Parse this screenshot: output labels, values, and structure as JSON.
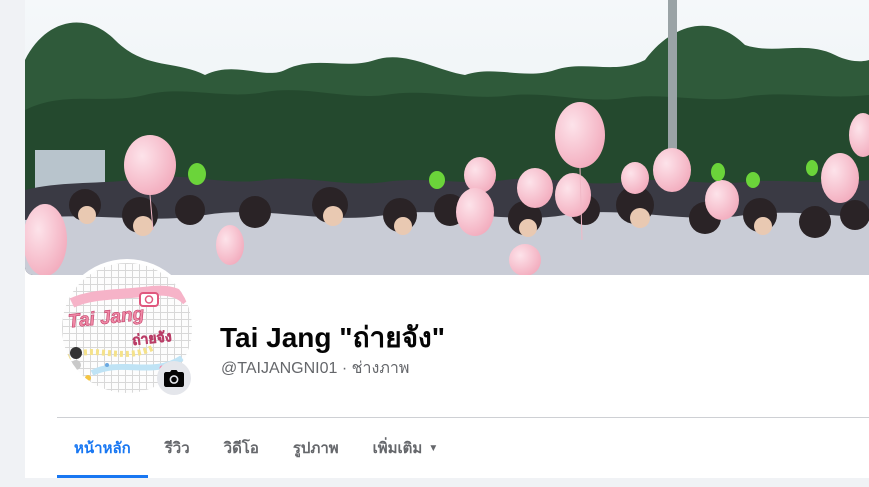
{
  "profile": {
    "name": "Tai Jang \"ถ่ายจัง\"",
    "username": "@TAIJANGNI01",
    "separator": "·",
    "category": "ช่างภาพ",
    "logo_text_1": "Tai Jang",
    "logo_text_2": "ถ่ายจัง"
  },
  "tabs": [
    {
      "label": "หน้าหลัก",
      "active": true
    },
    {
      "label": "รีวิว",
      "active": false
    },
    {
      "label": "วิดีโอ",
      "active": false
    },
    {
      "label": "รูปภาพ",
      "active": false
    },
    {
      "label": "เพิ่มเติม",
      "active": false,
      "dropdown": true
    }
  ],
  "icons": {
    "camera": "camera-icon",
    "dropdown": "caret-down-icon"
  },
  "colors": {
    "accent": "#1877f2",
    "text_primary": "#050505",
    "text_secondary": "#65676b",
    "divider": "#ced0d4"
  }
}
